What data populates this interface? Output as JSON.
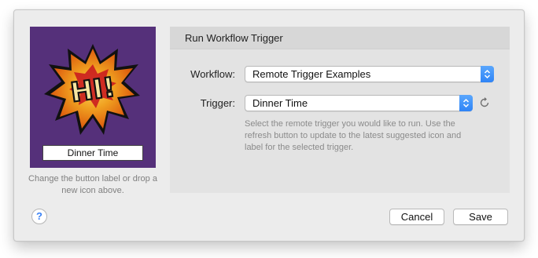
{
  "preview": {
    "icon_name": "comic-hi-burst-icon",
    "icon_text": "HI!",
    "button_label": "Dinner Time",
    "hint": "Change the button label or drop a new icon above.",
    "background_color": "#55307a"
  },
  "panel": {
    "title": "Run Workflow Trigger",
    "workflow": {
      "label": "Workflow:",
      "value": "Remote Trigger Examples"
    },
    "trigger": {
      "label": "Trigger:",
      "value": "Dinner Time"
    },
    "helper_text": "Select the remote trigger you would like to run. Use the refresh button to update to the latest suggested icon and label for the selected trigger."
  },
  "footer": {
    "help_label": "?",
    "cancel_label": "Cancel",
    "save_label": "Save"
  },
  "colors": {
    "accent": "#3a8cf8",
    "window_bg": "#ececec",
    "panel_bg": "#e3e3e3"
  }
}
